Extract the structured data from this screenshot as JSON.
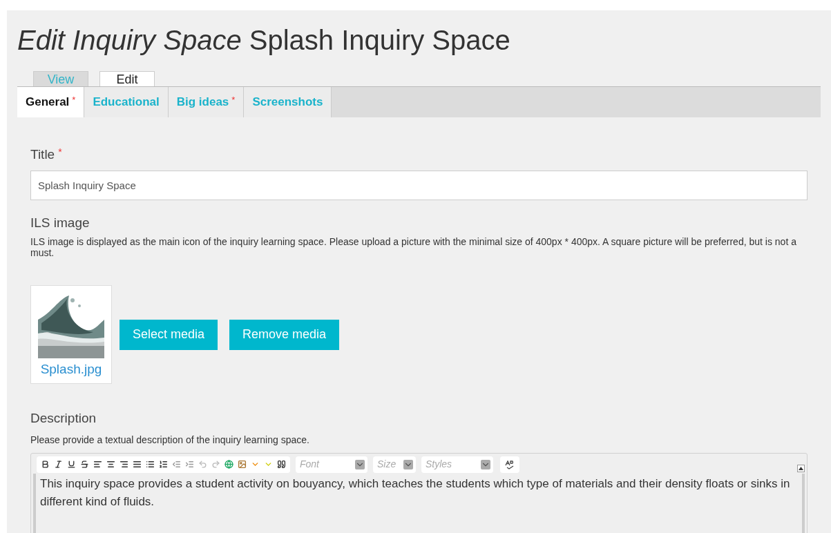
{
  "page_title": {
    "prefix": "Edit Inquiry Space",
    "name": "Splash Inquiry Space"
  },
  "view_tabs": [
    {
      "label": "View",
      "selected": false
    },
    {
      "label": "Edit",
      "selected": true
    }
  ],
  "form_tabs": [
    {
      "label": "General",
      "required_mark": "*",
      "selected": true
    },
    {
      "label": "Educational",
      "selected": false
    },
    {
      "label": "Big ideas",
      "required_mark": "*",
      "selected": false
    },
    {
      "label": "Screenshots",
      "selected": false
    }
  ],
  "title_field": {
    "label": "Title",
    "required_mark": "*",
    "value": "Splash Inquiry Space"
  },
  "image_field": {
    "label": "ILS image",
    "help": "ILS image is displayed as the main icon of the inquiry learning space. Please upload a picture with the minimal size of 400px * 400px. A square picture will be preferred, but is not a must.",
    "file_name": "Splash.jpg",
    "buttons": [
      "Select media",
      "Remove media"
    ]
  },
  "description_field": {
    "label": "Description",
    "help": "Please provide a textual description of the inquiry learning space.",
    "dropdowns": [
      "Font",
      "Size",
      "Styles"
    ],
    "value": "This inquiry space provides a student activity on bouyancy, which teaches the students which type of materials and their density floats or sinks in different kind of fluids."
  }
}
